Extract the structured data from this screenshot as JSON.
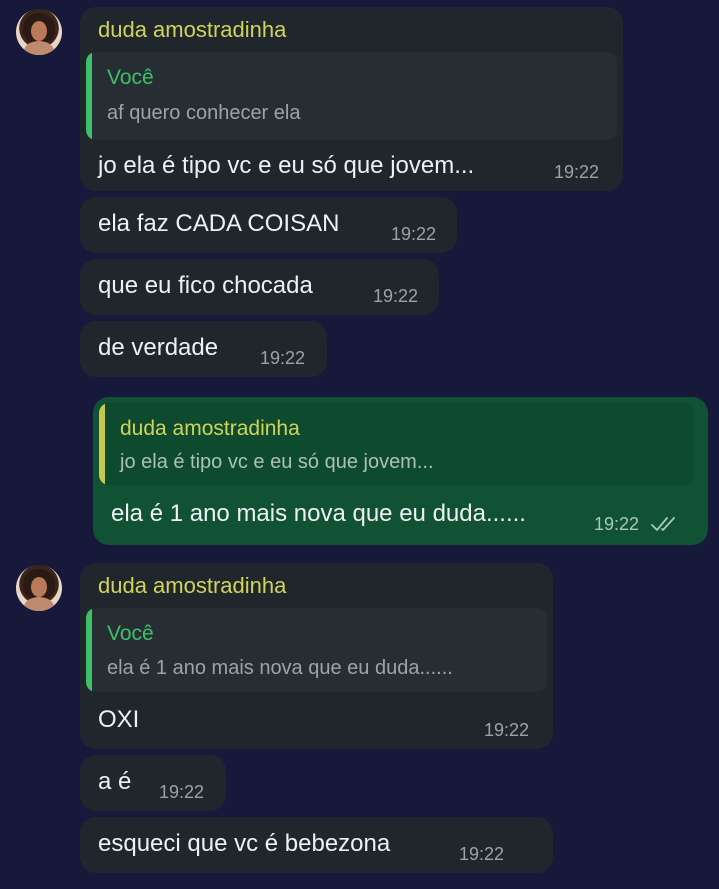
{
  "contact_name": "duda amostradinha",
  "colors": {
    "background": "#17193a",
    "incoming_bubble": "#1f272c",
    "outgoing_bubble": "#115234",
    "sender_name": "#d2d35a",
    "reply_self": "#3fbf6a"
  },
  "messages": [
    {
      "direction": "incoming",
      "sender": "duda amostradinha",
      "reply": {
        "name": "Você",
        "text": "af quero conhecer ela"
      },
      "text": "jo ela é tipo vc e eu só que jovem...",
      "time": "19:22"
    },
    {
      "direction": "incoming",
      "text": "ela faz CADA COISAN",
      "time": "19:22"
    },
    {
      "direction": "incoming",
      "text": "que eu fico chocada",
      "time": "19:22"
    },
    {
      "direction": "incoming",
      "text": "de verdade",
      "time": "19:22"
    },
    {
      "direction": "outgoing",
      "reply": {
        "name": "duda amostradinha",
        "text": "jo ela é tipo vc e eu só que jovem..."
      },
      "text": "ela é 1 ano mais nova que eu duda......",
      "time": "19:22",
      "status": "read"
    },
    {
      "direction": "incoming",
      "sender": "duda amostradinha",
      "reply": {
        "name": "Você",
        "text": "ela é 1 ano mais nova que eu duda......"
      },
      "text": "OXI",
      "time": "19:22"
    },
    {
      "direction": "incoming",
      "text": "a é",
      "time": "19:22"
    },
    {
      "direction": "incoming",
      "text": "esqueci que vc é bebezona",
      "time": "19:22"
    }
  ]
}
